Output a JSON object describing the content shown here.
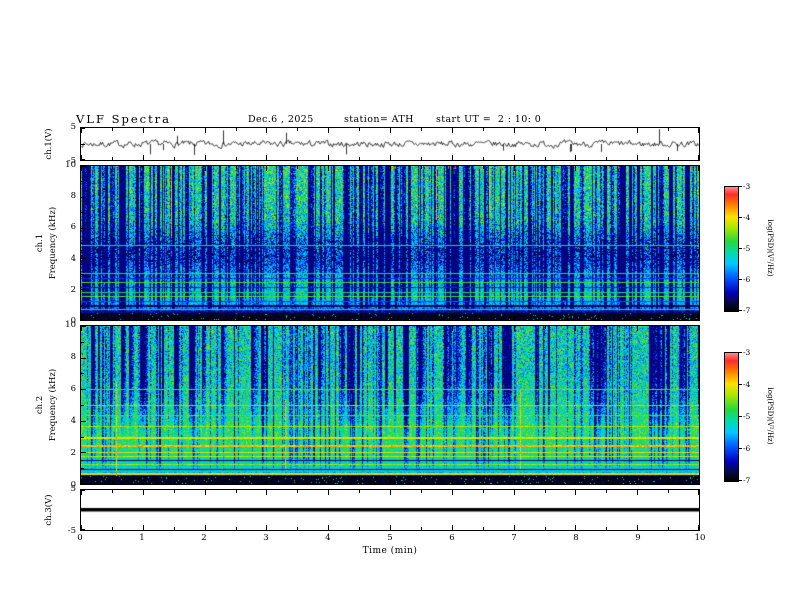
{
  "title": {
    "text": "VLF Spectra",
    "date": "Dec.6 , 2025",
    "station": "station= ATH",
    "start_ut": "start UT =  2 : 10: 0"
  },
  "x_axis": {
    "label": "Time (min)",
    "min": 0,
    "max": 10,
    "ticks": [
      0,
      1,
      2,
      3,
      4,
      5,
      6,
      7,
      8,
      9,
      10
    ]
  },
  "panels": {
    "ch1v": {
      "ylabel": "ch.1(V)",
      "ymin": -5,
      "ymax": 5,
      "yticks": [
        5,
        -5
      ]
    },
    "ch1spec": {
      "ylabel_channel": "ch.1",
      "ylabel_axis": "Frequency (kHz)",
      "ymin": 0,
      "ymax": 10,
      "yticks": [
        10,
        8,
        6,
        4,
        2,
        0
      ]
    },
    "ch2spec": {
      "ylabel_channel": "ch.2",
      "ylabel_axis": "Frequency (kHz)",
      "ymin": 0,
      "ymax": 10,
      "yticks": [
        10,
        8,
        6,
        4,
        2,
        0
      ]
    },
    "ch3v": {
      "ylabel": "ch.3(V)",
      "ymin": -5,
      "ymax": 5,
      "yticks": [
        5,
        -5
      ]
    }
  },
  "colorbar": {
    "label": "log(PSD)(V²/Hz)",
    "ticks": [
      -3,
      -4,
      -5,
      -6,
      -7
    ],
    "min": -7,
    "max": -3
  },
  "chart_data": {
    "type": "heatmap",
    "title": "VLF Spectra",
    "date": "Dec.6 , 2025",
    "station": "ATH",
    "start_ut": "2 : 10 : 0",
    "x": {
      "label": "Time (min)",
      "range": [
        0,
        10
      ],
      "ticks": [
        0,
        1,
        2,
        3,
        4,
        5,
        6,
        7,
        8,
        9,
        10
      ]
    },
    "colorbar": {
      "label": "log(PSD)(V²/Hz)",
      "range": [
        -7,
        -3
      ],
      "ticks": [
        -3,
        -4,
        -5,
        -6,
        -7
      ]
    },
    "colormap": [
      [
        0,
        [
          0,
          0,
          0
        ]
      ],
      [
        0.07,
        [
          8,
          8,
          70
        ]
      ],
      [
        0.15,
        [
          0,
          0,
          190
        ]
      ],
      [
        0.27,
        [
          0,
          90,
          255
        ]
      ],
      [
        0.38,
        [
          0,
          200,
          255
        ]
      ],
      [
        0.47,
        [
          0,
          220,
          170
        ]
      ],
      [
        0.56,
        [
          40,
          215,
          60
        ]
      ],
      [
        0.67,
        [
          170,
          230,
          0
        ]
      ],
      [
        0.76,
        [
          255,
          225,
          0
        ]
      ],
      [
        0.86,
        [
          255,
          120,
          0
        ]
      ],
      [
        0.94,
        [
          255,
          45,
          40
        ]
      ],
      [
        1,
        [
          255,
          140,
          140
        ]
      ]
    ],
    "subplots": [
      {
        "name": "ch1_voltage",
        "type": "line",
        "ylabel": "ch.1(V)",
        "yrange": [
          -5,
          5
        ],
        "summary": "Broadband noise of about ±1 V around 0 V with frequent impulsive sferic spikes reaching ±5 V across the whole 10 min record.",
        "gen": {
          "seed": 7,
          "noise_v": 1.1,
          "spike_prob": 0.02,
          "spike_min_v": 1.8,
          "spike_max_v": 4.8,
          "down_fraction": 0.65
        }
      },
      {
        "name": "ch1_spectrogram",
        "type": "spectrogram",
        "ylabel": "Frequency (kHz)",
        "yrange": [
          0,
          10
        ],
        "summary": "Dense vertical sferic striations over a green background; broad dark-blue minimum near 3.5-5.5 kHz; layered cyan/blue horizontal lines below 3 kHz; black band below about 0.5 kHz.",
        "gen": {
          "seed": 42,
          "profile": [
            [
              0,
              0.5
            ],
            [
              0.35,
              0.46
            ],
            [
              0.45,
              0.34
            ],
            [
              0.52,
              0.24
            ],
            [
              0.6,
              0.22
            ],
            [
              0.68,
              0.32
            ],
            [
              0.74,
              0.4
            ],
            [
              0.86,
              0.44
            ],
            [
              0.915,
              0.32
            ],
            [
              0.945,
              0.12
            ],
            [
              1,
              0.06
            ]
          ],
          "noise": [
            [
              0,
              0.26
            ],
            [
              0.5,
              0.3
            ],
            [
              0.7,
              0.22
            ],
            [
              0.9,
              0.14
            ],
            [
              1,
              0.08
            ]
          ],
          "thin_stripes": 260,
          "thin_depth": [
            0.15,
            0.5
          ],
          "wide_stripes": 45,
          "wide_depth": [
            0.4,
            0.75
          ],
          "wide_w": [
            2,
            4
          ],
          "wide_fade": [
            0.86,
            0.95
          ],
          "top_spikes": 18,
          "vlines_warm": [
            [
              0.145,
              0.0,
              0.45,
              0.82
            ],
            [
              0.575,
              0.0,
              0.35,
              0.8
            ],
            [
              0.66,
              0.0,
              0.3,
              0.78
            ]
          ],
          "hlines": [
            [
              0.515,
              0.5,
              1
            ],
            [
              0.695,
              0.55,
              1
            ],
            [
              0.725,
              0.22,
              1
            ],
            [
              0.755,
              0.58,
              1
            ],
            [
              0.785,
              0.2,
              1
            ],
            [
              0.815,
              0.52,
              1
            ],
            [
              0.845,
              0.6,
              1
            ],
            [
              0.875,
              0.25,
              1
            ],
            [
              0.9,
              0.08,
              2
            ],
            [
              0.928,
              0.55,
              1
            ]
          ],
          "black_band": 0.952
        }
      },
      {
        "name": "ch2_spectrogram",
        "type": "spectrogram",
        "ylabel": "Frequency (kHz)",
        "yrange": [
          0,
          10
        ],
        "summary": "Blue sferic blobs concentrated above 6 kHz on a green background; yellow/orange horizontal interference lines between about 1.5 and 4 kHz; alternating yellow and black striations below 1.5 kHz; black band below about 0.5 kHz.",
        "gen": {
          "seed": 1337,
          "profile": [
            [
              0,
              0.47
            ],
            [
              0.25,
              0.45
            ],
            [
              0.4,
              0.47
            ],
            [
              0.55,
              0.5
            ],
            [
              0.65,
              0.54
            ],
            [
              0.75,
              0.52
            ],
            [
              0.85,
              0.48
            ],
            [
              0.92,
              0.42
            ],
            [
              0.945,
              0.1
            ],
            [
              1,
              0.05
            ]
          ],
          "noise": [
            [
              0,
              0.26
            ],
            [
              0.35,
              0.24
            ],
            [
              0.6,
              0.18
            ],
            [
              0.8,
              0.14
            ],
            [
              1,
              0.08
            ]
          ],
          "thin_stripes": 150,
          "thin_depth": [
            0.12,
            0.4
          ],
          "wide_stripes": 60,
          "wide_depth": [
            0.35,
            0.65
          ],
          "wide_w": [
            2,
            7
          ],
          "wide_fade": [
            0.32,
            0.72
          ],
          "top_spikes": 6,
          "vlines_warm": [
            [
              0.056,
              0.35,
              0.95,
              0.8
            ],
            [
              0.33,
              0.45,
              0.9,
              0.75
            ],
            [
              0.71,
              0.4,
              0.9,
              0.75
            ]
          ],
          "hlines": [
            [
              0.4,
              0.62,
              1
            ],
            [
              0.5,
              0.66,
              1
            ],
            [
              0.565,
              0.6,
              1
            ],
            [
              0.63,
              0.68,
              1
            ],
            [
              0.7,
              0.72,
              2
            ],
            [
              0.755,
              0.8,
              2
            ],
            [
              0.795,
              0.74,
              1
            ],
            [
              0.825,
              0.7,
              1
            ],
            [
              0.848,
              0.1,
              1
            ],
            [
              0.872,
              0.66,
              1
            ],
            [
              0.905,
              0.1,
              1
            ],
            [
              0.932,
              0.72,
              2
            ]
          ],
          "black_band": 0.948
        }
      },
      {
        "name": "ch3_voltage",
        "type": "line",
        "ylabel": "ch.3(V)",
        "yrange": [
          -5,
          5
        ],
        "summary": "Constant 0 V (flat thick black line, channel inactive).",
        "gen": {
          "flat": 0
        }
      }
    ]
  }
}
